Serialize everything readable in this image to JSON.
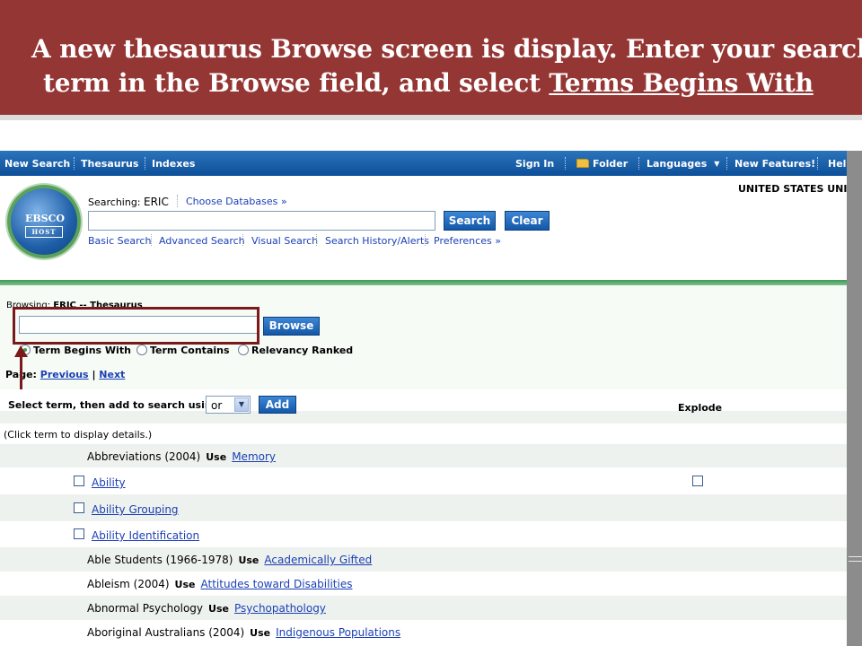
{
  "slide": {
    "caption_line1": "A new thesaurus Browse screen is display. Enter your search",
    "caption_line2_lead": "term in the Browse field, and select ",
    "caption_line2_emphasis": "Terms Begins With"
  },
  "topnav": {
    "left": [
      "New Search",
      "Thesaurus",
      "Indexes"
    ],
    "sign_in": "Sign In",
    "folder": "Folder",
    "languages": "Languages",
    "new_features": "New Features!",
    "help": "Help"
  },
  "header": {
    "logo_top": "EBSCO",
    "logo_bottom": "HOST",
    "searching_label": "Searching:",
    "database": "ERIC",
    "choose_databases": "Choose Databases »",
    "institution": "UNITED STATES UNI",
    "search_value": "",
    "search_button": "Search",
    "clear_button": "Clear",
    "links": [
      "Basic Search",
      "Advanced Search",
      "Visual Search",
      "Search History/Alerts",
      "Preferences »"
    ]
  },
  "browse": {
    "browsing_label": "Browsing:",
    "browsing_value": "ERIC -- Thesaurus",
    "input_value": "",
    "browse_button": "Browse",
    "options": [
      {
        "label": "Term Begins With",
        "selected": true
      },
      {
        "label": "Term Contains",
        "selected": false
      },
      {
        "label": "Relevancy Ranked",
        "selected": false
      }
    ],
    "page_label": "Page:",
    "previous": "Previous",
    "next": "Next"
  },
  "select": {
    "label": "Select term, then add to search using:",
    "operator": "or",
    "add_button": "Add",
    "explode_header": "Explode"
  },
  "terms": {
    "note": "(Click term to display details.)",
    "rows": [
      {
        "term": "Abbreviations (2004)",
        "use": "Use",
        "link": "Memory"
      },
      {
        "term": "",
        "use": "",
        "link": "Ability"
      },
      {
        "term": "",
        "use": "",
        "link": "Ability Grouping"
      },
      {
        "term": "",
        "use": "",
        "link": "Ability Identification"
      },
      {
        "term": "Able Students (1966-1978)",
        "use": "Use",
        "link": "Academically Gifted"
      },
      {
        "term": "Ableism (2004)",
        "use": "Use",
        "link": "Attitudes toward Disabilities"
      },
      {
        "term": "Abnormal Psychology",
        "use": "Use",
        "link": "Psychopathology"
      },
      {
        "term": "Aboriginal Australians (2004)",
        "use": "Use",
        "link": "Indigenous Populations"
      }
    ]
  }
}
